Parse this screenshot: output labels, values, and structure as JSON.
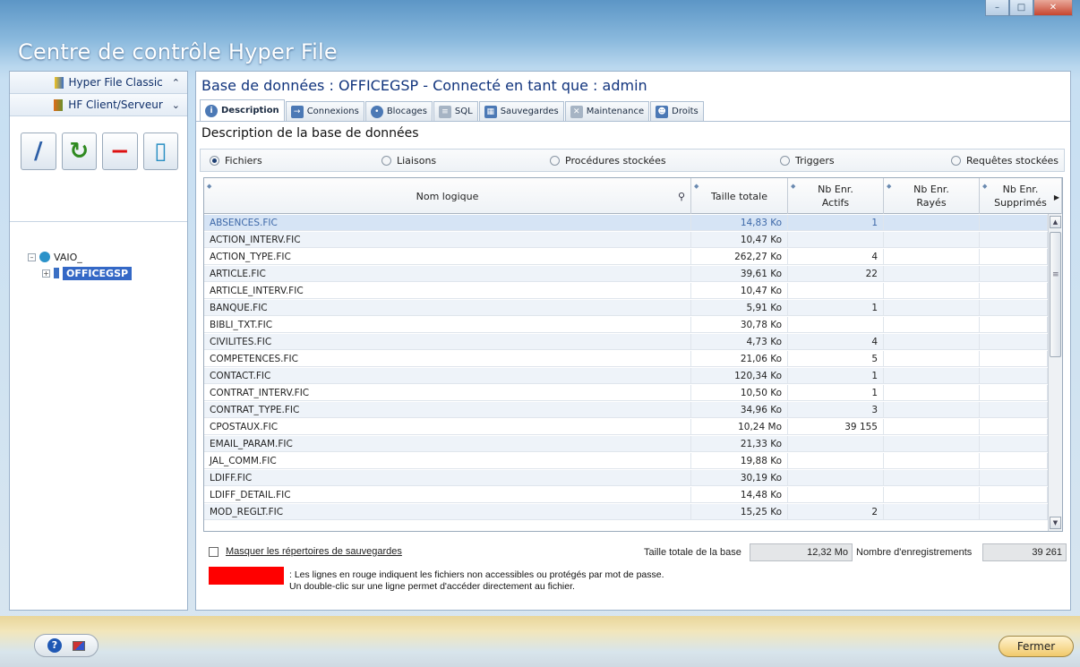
{
  "window": {
    "title": "Centre de contrôle Hyper File",
    "controls": [
      "minimize",
      "maximize",
      "close"
    ]
  },
  "sidebar": {
    "sections": [
      {
        "label": "Hyper File Classic",
        "chevron": "^"
      },
      {
        "label": "HF Client/Serveur",
        "chevron": "v"
      }
    ],
    "tools": [
      {
        "icon": "key-icon",
        "glyph": "∕"
      },
      {
        "icon": "refresh-icon",
        "glyph": "↻"
      },
      {
        "icon": "minus-icon",
        "glyph": "−"
      },
      {
        "icon": "trash-icon",
        "glyph": "▯"
      }
    ],
    "tree": {
      "server": "VAIO_",
      "database": "OFFICEGSP"
    }
  },
  "main": {
    "db_title": "Base de données : OFFICEGSP - Connecté en tant que : admin",
    "tabs": [
      {
        "label": "Description",
        "active": true
      },
      {
        "label": "Connexions"
      },
      {
        "label": "Blocages"
      },
      {
        "label": "SQL"
      },
      {
        "label": "Sauvegardes"
      },
      {
        "label": "Maintenance"
      },
      {
        "label": "Droits"
      }
    ],
    "section_title": "Description de la base de données",
    "radios": [
      {
        "label": "Fichiers",
        "checked": true
      },
      {
        "label": "Liaisons",
        "checked": false
      },
      {
        "label": "Procédures stockées",
        "checked": false
      },
      {
        "label": "Triggers",
        "checked": false
      },
      {
        "label": "Requêtes stockées",
        "checked": false
      }
    ],
    "grid": {
      "columns": [
        {
          "label": "Nom logique"
        },
        {
          "label": "Taille totale"
        },
        {
          "label": "Nb Enr.\nActifs"
        },
        {
          "label": "Nb Enr.\nRayés"
        },
        {
          "label": "Nb Enr.\nSupprimés"
        }
      ],
      "rows": [
        [
          "ABSENCES.FIC",
          "14,83 Ko",
          "1",
          "",
          ""
        ],
        [
          "ACTION_INTERV.FIC",
          "10,47 Ko",
          "",
          "",
          ""
        ],
        [
          "ACTION_TYPE.FIC",
          "262,27 Ko",
          "4",
          "",
          ""
        ],
        [
          "ARTICLE.FIC",
          "39,61 Ko",
          "22",
          "",
          ""
        ],
        [
          "ARTICLE_INTERV.FIC",
          "10,47 Ko",
          "",
          "",
          ""
        ],
        [
          "BANQUE.FIC",
          "5,91 Ko",
          "1",
          "",
          ""
        ],
        [
          "BIBLI_TXT.FIC",
          "30,78 Ko",
          "",
          "",
          ""
        ],
        [
          "CIVILITES.FIC",
          "4,73 Ko",
          "4",
          "",
          ""
        ],
        [
          "COMPETENCES.FIC",
          "21,06 Ko",
          "5",
          "",
          ""
        ],
        [
          "CONTACT.FIC",
          "120,34 Ko",
          "1",
          "",
          ""
        ],
        [
          "CONTRAT_INTERV.FIC",
          "10,50 Ko",
          "1",
          "",
          ""
        ],
        [
          "CONTRAT_TYPE.FIC",
          "34,96 Ko",
          "3",
          "",
          ""
        ],
        [
          "CPOSTAUX.FIC",
          "10,24 Mo",
          "39 155",
          "",
          ""
        ],
        [
          "EMAIL_PARAM.FIC",
          "21,33 Ko",
          "",
          "",
          ""
        ],
        [
          "JAL_COMM.FIC",
          "19,88 Ko",
          "",
          "",
          ""
        ],
        [
          "LDIFF.FIC",
          "30,19 Ko",
          "",
          "",
          ""
        ],
        [
          "LDIFF_DETAIL.FIC",
          "14,48 Ko",
          "",
          "",
          ""
        ],
        [
          "MOD_REGLT.FIC",
          "15,25 Ko",
          "2",
          "",
          ""
        ]
      ],
      "selected_row": 0
    },
    "mask_label": "Masquer les répertoires de sauvegardes",
    "total_label": "Taille totale de la base",
    "total_value": "12,32 Mo",
    "count_label": "Nombre d'enregistrements",
    "count_value": "39 261",
    "legend_line1": ": Les lignes en rouge indiquent les fichiers non accessibles ou protégés par mot de passe.",
    "legend_line2": "Un double-clic sur une ligne permet d'accéder directement au fichier.",
    "legend_color": "#ff0000"
  },
  "footer": {
    "close_label": "Fermer",
    "help_glyph": "?"
  }
}
